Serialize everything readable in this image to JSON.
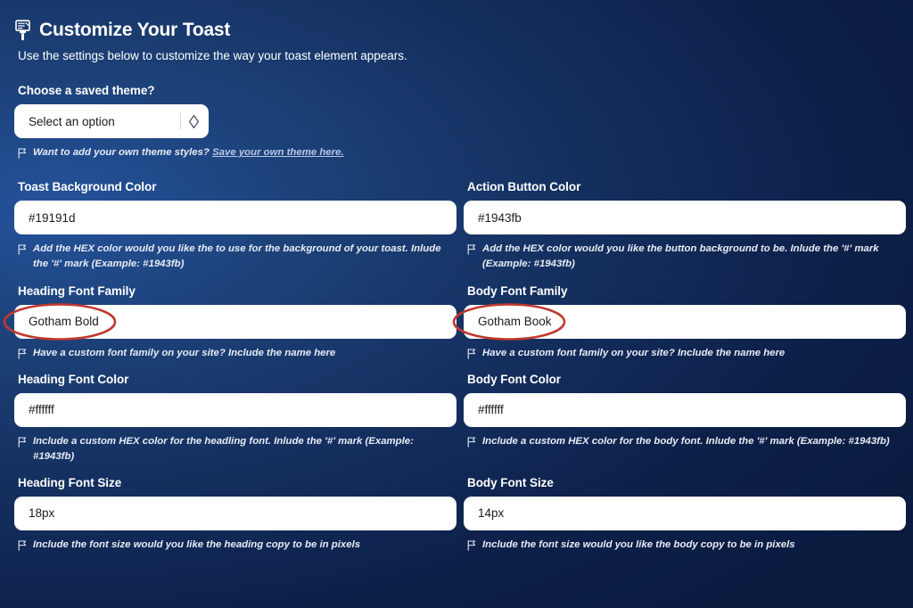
{
  "header": {
    "icon": "paintbrush-icon",
    "title": "Customize Your Toast",
    "subtitle": "Use the settings below to customize the way your toast element appears."
  },
  "theme_select": {
    "label": "Choose a saved theme?",
    "value": "Select an option",
    "placeholder": "Select an option",
    "chevron_icon": "chevron-up-down-icon",
    "helper_prefix": "Want to add your own theme styles?",
    "helper_link": "Save your own theme here.",
    "helper_icon": "flag-icon"
  },
  "fields": [
    {
      "name": "toast-background-color",
      "label": "Toast Background Color",
      "value": "#19191d",
      "placeholder": "#19191d",
      "helper": "Add the HEX color would you like the to use for the background of your toast. Inlude the '#' mark (Example: #1943fb)",
      "annotated": false
    },
    {
      "name": "action-button-color",
      "label": "Action Button Color",
      "value": "#1943fb",
      "placeholder": "#1943fb",
      "helper": "Add the HEX color would you like the button background to be. Inlude the '#' mark (Example: #1943fb)",
      "annotated": false
    },
    {
      "name": "heading-font-family",
      "label": "Heading Font Family",
      "value": "Gotham Bold",
      "placeholder": "Gotham Bold",
      "helper": "Have a custom font family on your site? Include the name here",
      "annotated": true
    },
    {
      "name": "body-font-family",
      "label": "Body Font Family",
      "value": "Gotham Book",
      "placeholder": "Gotham Book",
      "helper": "Have a custom font family on your site? Include the name here",
      "annotated": true
    },
    {
      "name": "heading-font-color",
      "label": "Heading Font Color",
      "value": "#ffffff",
      "placeholder": "#ffffff",
      "helper": "Include a custom HEX color for the headling font. Inlude the '#' mark (Example: #1943fb)",
      "annotated": false
    },
    {
      "name": "body-font-color",
      "label": "Body Font Color",
      "value": "#ffffff",
      "placeholder": "#ffffff",
      "helper": "Include a custom HEX color for the body font. Inlude the '#' mark (Example: #1943fb)",
      "annotated": false
    },
    {
      "name": "heading-font-size",
      "label": "Heading Font Size",
      "value": "18px",
      "placeholder": "18px",
      "helper": "Include the font size would you like the heading copy to be in pixels",
      "annotated": false
    },
    {
      "name": "body-font-size",
      "label": "Body Font Size",
      "value": "14px",
      "placeholder": "14px",
      "helper": "Include the font size would you like the body copy to be in pixels",
      "annotated": false
    }
  ],
  "colors": {
    "background_light": "#24529b",
    "background_dark": "#091a3c",
    "input_background": "#ffffff",
    "input_text": "#1b1b1f",
    "label_text": "#ffffff",
    "helper_text": "#e8ecf5",
    "link": "#b9c7e8",
    "annotation": "#c0392f"
  }
}
